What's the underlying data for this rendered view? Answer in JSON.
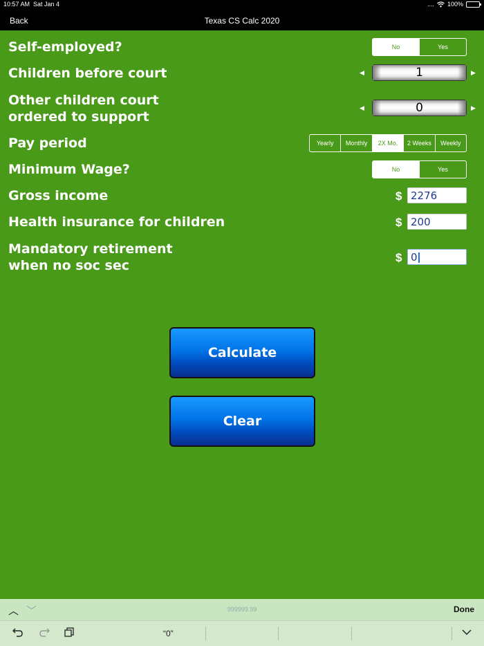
{
  "status": {
    "time": "10:57 AM",
    "date": "Sat Jan 4",
    "signal": "....",
    "battery": "100%"
  },
  "nav": {
    "back": "Back",
    "title": "Texas CS Calc 2020"
  },
  "rows": {
    "self_employed": {
      "label": "Self-employed?",
      "options": [
        "No",
        "Yes"
      ],
      "selected": "No"
    },
    "children_before_court": {
      "label": "Children before court",
      "value": "1"
    },
    "other_children": {
      "label_line1": "Other children court",
      "label_line2": "ordered to support",
      "value": "0"
    },
    "pay_period": {
      "label": "Pay period",
      "options": [
        "Yearly",
        "Monthly",
        "2X Mo.",
        "2 Weeks",
        "Weekly"
      ],
      "selected": "2X Mo."
    },
    "minimum_wage": {
      "label": "Minimum Wage?",
      "options": [
        "No",
        "Yes"
      ],
      "selected": "No"
    },
    "gross_income": {
      "label": "Gross income",
      "currency": "$",
      "value": "2276"
    },
    "health_insurance": {
      "label": "Health insurance for children",
      "currency": "$",
      "value": "200"
    },
    "retirement": {
      "label_line1": "Mandatory retirement",
      "label_line2": "when no soc sec",
      "currency": "$",
      "value": "0"
    }
  },
  "buttons": {
    "calculate": "Calculate",
    "clear": "Clear"
  },
  "keyboard": {
    "hint": "999999.99",
    "done": "Done",
    "suggestion": "“0”"
  },
  "colors": {
    "background": "#4a9a1a",
    "button_blue": "#0074e8",
    "bar": "#000000"
  }
}
